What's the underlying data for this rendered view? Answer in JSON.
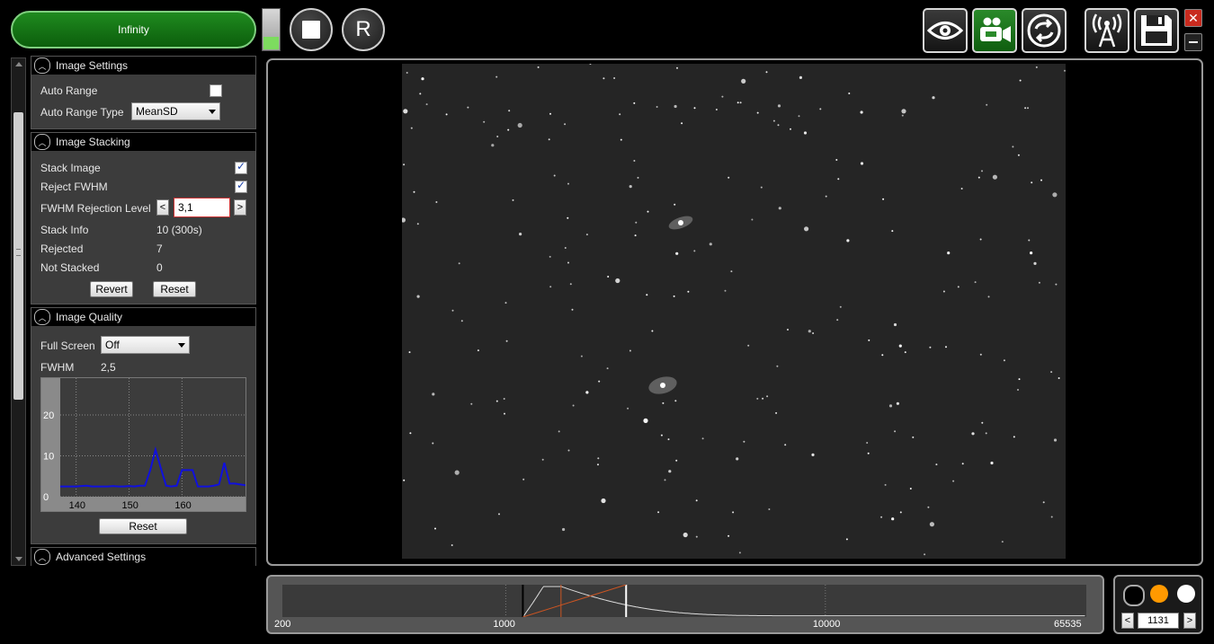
{
  "toolbar": {
    "capture_label": "Infinity",
    "stop_icon": "stop-icon",
    "reset_label": "R",
    "capture_level": 0.3,
    "icons": [
      "eye-icon",
      "camera-icon",
      "loop-icon",
      "broadcast-icon",
      "save-icon"
    ]
  },
  "sections": {
    "image_settings": {
      "title": "Image Settings",
      "auto_range_label": "Auto Range",
      "auto_range_checked": false,
      "auto_range_type_label": "Auto Range Type",
      "auto_range_type_value": "MeanSD"
    },
    "image_stacking": {
      "title": "Image Stacking",
      "stack_image_label": "Stack Image",
      "stack_image_checked": true,
      "reject_fwhm_label": "Reject FWHM",
      "reject_fwhm_checked": true,
      "fwhm_rejection_label": "FWHM Rejection Level",
      "fwhm_rejection_value": "3,1",
      "dec_label": "<",
      "inc_label": ">",
      "stack_info_label": "Stack Info",
      "stack_info_value": "10 (300s)",
      "rejected_label": "Rejected",
      "rejected_value": "7",
      "not_stacked_label": "Not Stacked",
      "not_stacked_value": "0",
      "revert_label": "Revert",
      "reset_label": "Reset"
    },
    "image_quality": {
      "title": "Image Quality",
      "full_screen_label": "Full Screen",
      "full_screen_value": "Off",
      "fwhm_label": "FWHM",
      "fwhm_value": "2,5",
      "reset_label": "Reset"
    },
    "advanced_settings": {
      "title": "Advanced Settings"
    }
  },
  "chart_data": {
    "type": "line",
    "title": "",
    "xlabel": "",
    "ylabel": "",
    "x_ticks": [
      "140",
      "150",
      "160"
    ],
    "y_ticks": [
      "0",
      "10",
      "20"
    ],
    "xlim": [
      137,
      172
    ],
    "ylim": [
      0,
      29
    ],
    "grid": true,
    "series": [
      {
        "color": "#1010dd",
        "x": [
          137,
          138,
          139,
          140,
          141,
          142,
          143,
          144,
          145,
          146,
          147,
          148,
          149,
          150,
          151,
          152,
          153,
          154,
          155,
          156,
          157,
          158,
          159,
          160,
          161,
          162,
          163,
          164,
          165,
          166,
          167,
          168,
          169,
          170,
          171,
          172
        ],
        "y": [
          2.5,
          2.5,
          2.5,
          2.5,
          2.6,
          2.7,
          2.5,
          2.5,
          2.5,
          2.5,
          2.6,
          2.5,
          2.5,
          2.6,
          2.5,
          2.7,
          2.7,
          6.5,
          11.5,
          7,
          2.7,
          2.5,
          2.7,
          6.5,
          6.5,
          6.5,
          2.5,
          2.5,
          2.5,
          2.7,
          3,
          8.3,
          3.2,
          3.2,
          3,
          2.8
        ]
      }
    ]
  },
  "histogram": {
    "tick_labels": [
      "200",
      "1000",
      "10000",
      "65535"
    ],
    "black_point": 1131,
    "white_point": 2380,
    "line_color": "#cc5522"
  },
  "color_dots": {
    "colors": [
      "#000000",
      "#ff9900",
      "#ffffff"
    ],
    "dec_label": "<",
    "inc_label": ">",
    "value": "1131"
  }
}
